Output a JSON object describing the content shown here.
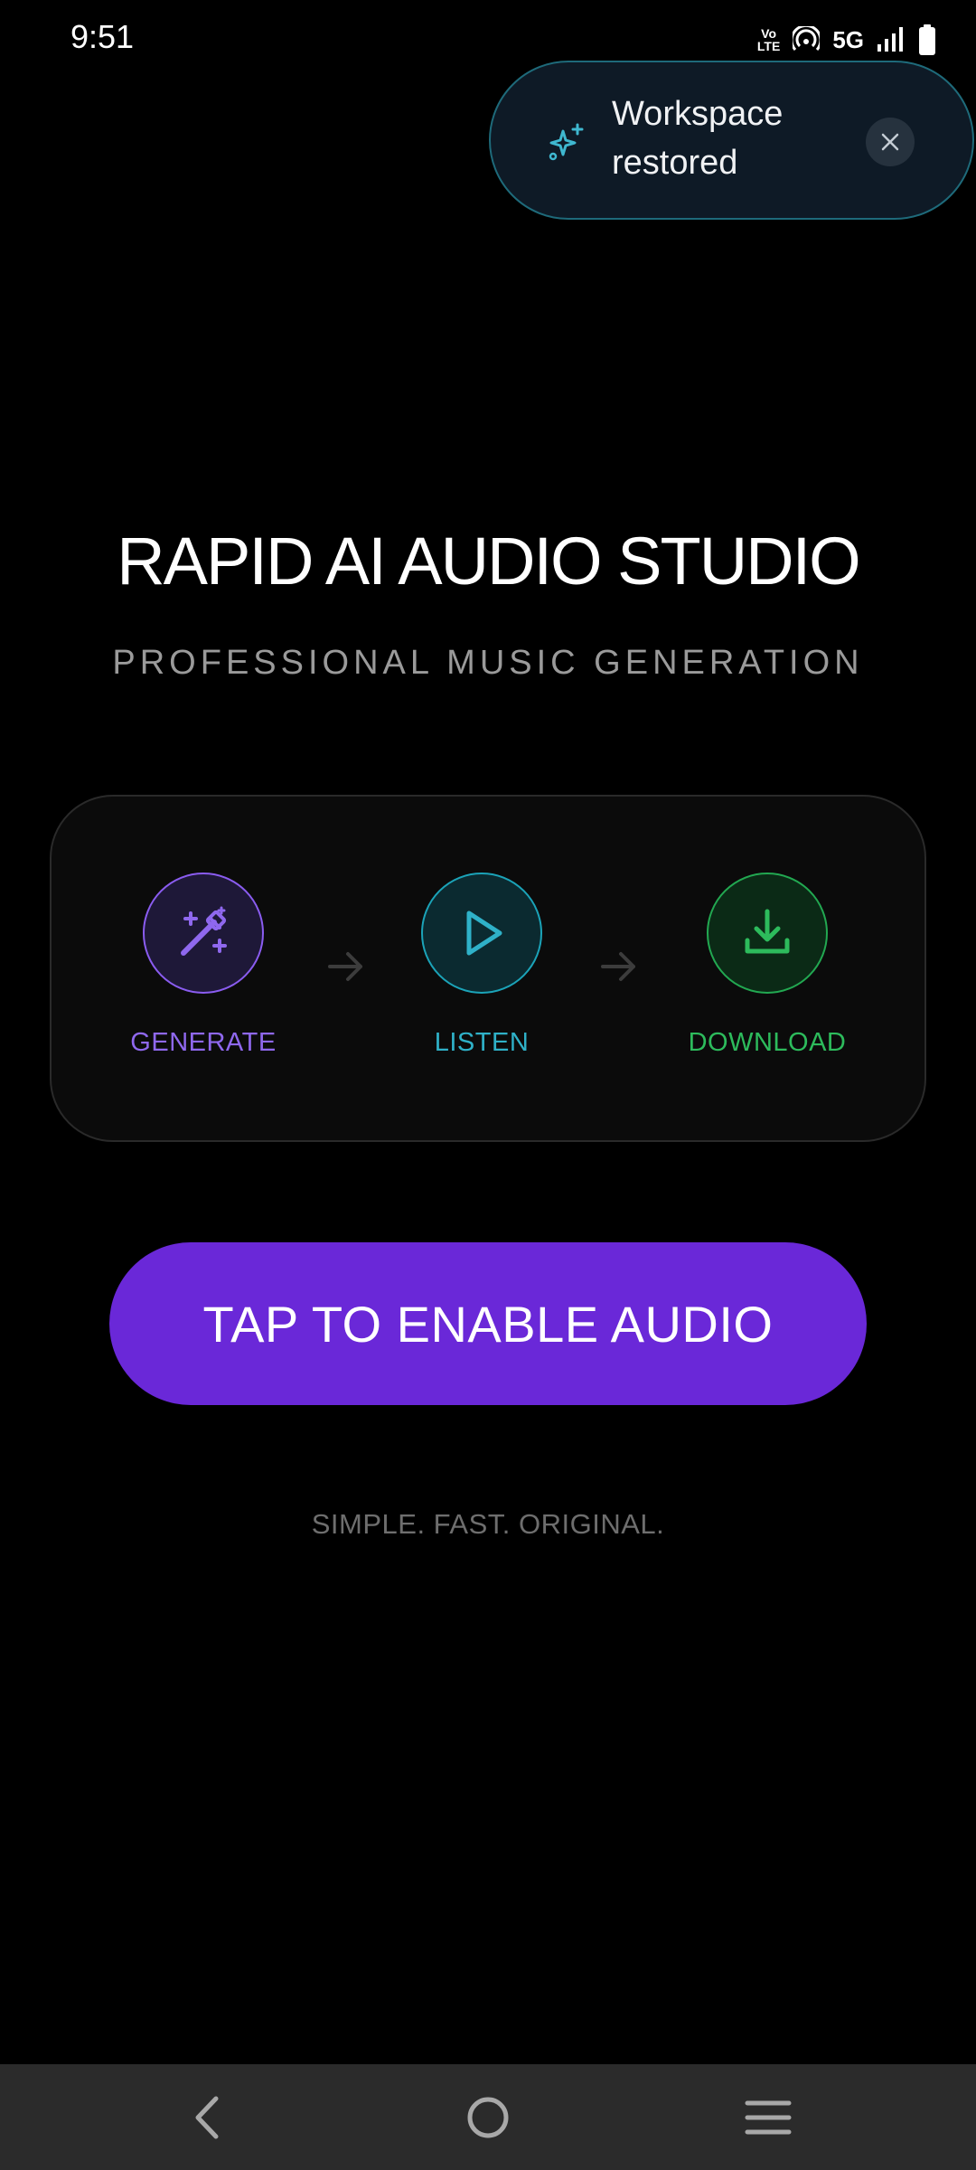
{
  "status_bar": {
    "time": "9:51",
    "volte_top": "Vo",
    "volte_bottom": "LTE",
    "network": "5G"
  },
  "toast": {
    "message": "Workspace restored",
    "icon": "sparkle-icon",
    "close_icon": "close-icon"
  },
  "header": {
    "title": "RAPID AI AUDIO STUDIO",
    "subtitle": "PROFESSIONAL MUSIC GENERATION"
  },
  "steps": [
    {
      "label": "GENERATE",
      "icon": "magic-wand-icon",
      "color": "#8f68ee"
    },
    {
      "label": "LISTEN",
      "icon": "play-icon",
      "color": "#2fb1c8"
    },
    {
      "label": "DOWNLOAD",
      "icon": "download-icon",
      "color": "#2dbb5c"
    }
  ],
  "main": {
    "enable_button_label": "TAP TO ENABLE AUDIO",
    "tagline": "SIMPLE. FAST. ORIGINAL."
  },
  "colors": {
    "accent": "#6a28d8",
    "toast_border": "#1e6a7a",
    "background": "#000000"
  },
  "nav_bar": {
    "back_icon": "back-chevron-icon",
    "home_icon": "home-circle-icon",
    "menu_icon": "menu-lines-icon"
  }
}
